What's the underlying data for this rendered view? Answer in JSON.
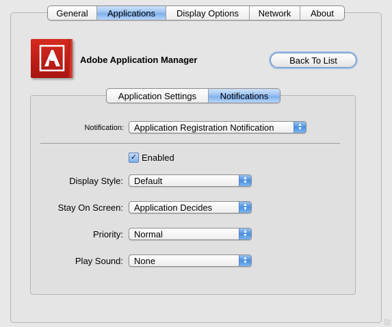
{
  "top_tabs": [
    {
      "label": "General"
    },
    {
      "label": "Applications"
    },
    {
      "label": "Display Options"
    },
    {
      "label": "Network"
    },
    {
      "label": "About"
    }
  ],
  "top_tabs_selected": "Applications",
  "app": {
    "title": "Adobe Application Manager",
    "icon": "adobe-logo",
    "back_button": "Back To List"
  },
  "sub_tabs": [
    {
      "label": "Application Settings"
    },
    {
      "label": "Notifications"
    }
  ],
  "sub_tabs_selected": "Notifications",
  "form": {
    "notification_label": "Notification:",
    "notification_value": "Application Registration Notification",
    "enabled_label": "Enabled",
    "enabled_checked": true,
    "checkmark": "✓",
    "display_style_label": "Display Style:",
    "display_style_value": "Default",
    "stay_on_screen_label": "Stay On Screen:",
    "stay_on_screen_value": "Application Decides",
    "priority_label": "Priority:",
    "priority_value": "Normal",
    "play_sound_label": "Play Sound:",
    "play_sound_value": "None"
  },
  "colors": {
    "selected_tab": "#8db8ee",
    "adobe_red": "#c41f17",
    "popup_arrow": "#4a8fe0"
  }
}
